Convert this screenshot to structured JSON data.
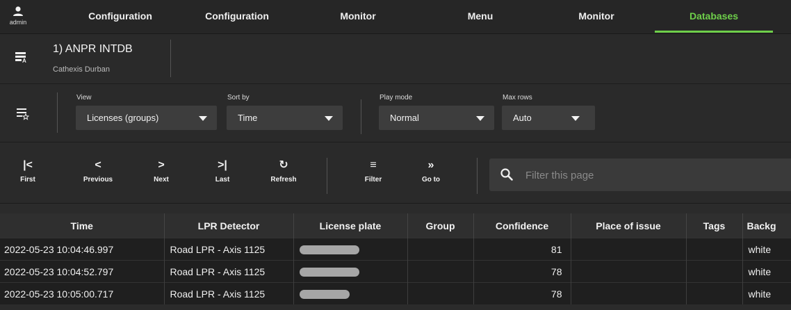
{
  "user": {
    "name": "admin"
  },
  "nav": {
    "tabs": [
      {
        "label": "Configuration"
      },
      {
        "label": "Configuration"
      },
      {
        "label": "Monitor"
      },
      {
        "label": "Menu"
      },
      {
        "label": "Monitor"
      },
      {
        "label": "Databases"
      }
    ],
    "active_index": 5,
    "accent_color": "#6ecf4a"
  },
  "database": {
    "title": "1) ANPR INTDB",
    "subtitle": "Cathexis Durban",
    "icon": "database-list-icon"
  },
  "view_options": {
    "icon": "list-star-icon",
    "view": {
      "label": "View",
      "value": "Licenses (groups)"
    },
    "sort_by": {
      "label": "Sort by",
      "value": "Time"
    },
    "play_mode": {
      "label": "Play mode",
      "value": "Normal"
    },
    "max_rows": {
      "label": "Max rows",
      "value": "Auto"
    }
  },
  "toolbar": {
    "first": {
      "label": "First",
      "icon": "skip-first-icon"
    },
    "previous": {
      "label": "Previous",
      "icon": "chevron-left-icon"
    },
    "next": {
      "label": "Next",
      "icon": "chevron-right-icon"
    },
    "last": {
      "label": "Last",
      "icon": "skip-last-icon"
    },
    "refresh": {
      "label": "Refresh",
      "icon": "refresh-icon"
    },
    "filter": {
      "label": "Filter",
      "icon": "filter-icon"
    },
    "goto": {
      "label": "Go to",
      "icon": "double-chevron-right-icon"
    }
  },
  "search": {
    "placeholder": "Filter this page",
    "value": ""
  },
  "table": {
    "columns": [
      "Time",
      "LPR Detector",
      "License plate",
      "Group",
      "Confidence",
      "Place of issue",
      "Tags",
      "Backg"
    ],
    "rows": [
      {
        "time": "2022-05-23 10:04:46.997",
        "detector": "Road LPR - Axis 1125",
        "plate": "",
        "group": "",
        "confidence": "81",
        "place": "",
        "tags": "",
        "background": "white"
      },
      {
        "time": "2022-05-23 10:04:52.797",
        "detector": "Road LPR - Axis 1125",
        "plate": "",
        "group": "",
        "confidence": "78",
        "place": "",
        "tags": "",
        "background": "white"
      },
      {
        "time": "2022-05-23 10:05:00.717",
        "detector": "Road LPR - Axis 1125",
        "plate": "",
        "group": "",
        "confidence": "78",
        "place": "",
        "tags": "",
        "background": "white"
      }
    ]
  }
}
